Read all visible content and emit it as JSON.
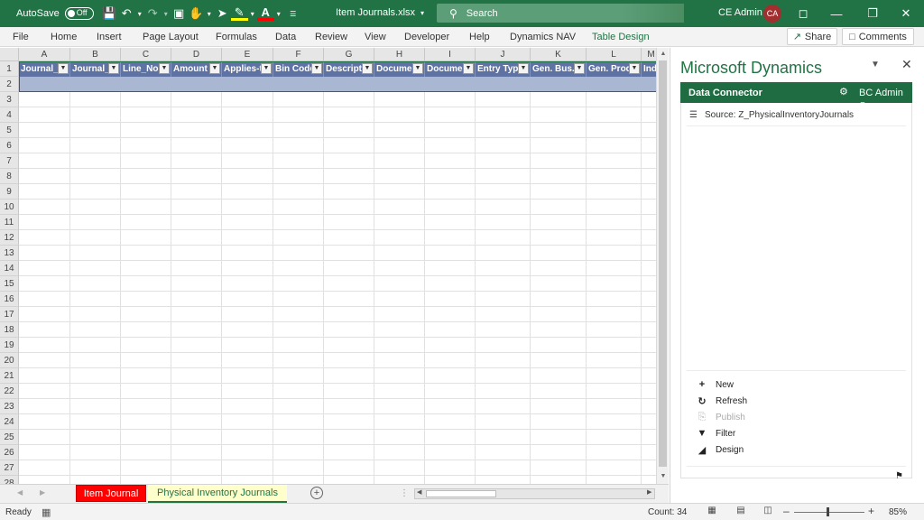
{
  "titlebar": {
    "autosave_label": "AutoSave",
    "autosave_state": "Off",
    "doc_title": "Item Journals.xlsx",
    "search_placeholder": "Search",
    "user_name": "CE Admin",
    "avatar_initials": "CA"
  },
  "ribbon": {
    "tabs": [
      "File",
      "Home",
      "Insert",
      "Page Layout",
      "Formulas",
      "Data",
      "Review",
      "View",
      "Developer",
      "Help",
      "Dynamics NAV",
      "Table Design"
    ],
    "share_label": "Share",
    "comments_label": "Comments"
  },
  "grid": {
    "columns": [
      "A",
      "B",
      "C",
      "D",
      "E",
      "F",
      "G",
      "H",
      "I",
      "J",
      "K",
      "L",
      "M"
    ],
    "rows": [
      "1",
      "2",
      "3",
      "4",
      "5",
      "6",
      "7",
      "8",
      "9",
      "10",
      "11",
      "12",
      "13",
      "14",
      "15",
      "16",
      "17",
      "18",
      "19",
      "20",
      "21",
      "22",
      "23",
      "24",
      "25",
      "26",
      "27",
      "28"
    ],
    "header_cells": [
      "Journal_B",
      "Journal_T",
      "Line_No",
      "Amount",
      "Applies-to",
      "Bin Code",
      "Descripti",
      "Documen",
      "Documen",
      "Entry Type",
      "Gen. Bus.",
      "Gen. Prod",
      "Ind"
    ]
  },
  "sheets": {
    "tab1": "Item Journal",
    "tab2": "Physical Inventory Journals"
  },
  "status": {
    "ready": "Ready",
    "count": "Count: 34",
    "zoom": "85%"
  },
  "pane": {
    "title": "Microsoft Dynamics",
    "connector_title": "Data Connector",
    "connector_user": "BC Admin",
    "source": "Source: Z_PhysicalInventoryJournals",
    "actions": [
      {
        "label": "New",
        "icon": "plus-icon",
        "enabled": true
      },
      {
        "label": "Refresh",
        "icon": "refresh-icon",
        "enabled": true
      },
      {
        "label": "Publish",
        "icon": "publish-icon",
        "enabled": false
      },
      {
        "label": "Filter",
        "icon": "filter-icon",
        "enabled": true
      },
      {
        "label": "Design",
        "icon": "design-icon",
        "enabled": true
      }
    ]
  },
  "colors": {
    "excel_green": "#217346",
    "table_header": "#5e73a3",
    "table_row": "#aab7d3",
    "sheet_tab_red": "#ff0000",
    "sheet_tab_yellow": "#ffffcc"
  }
}
